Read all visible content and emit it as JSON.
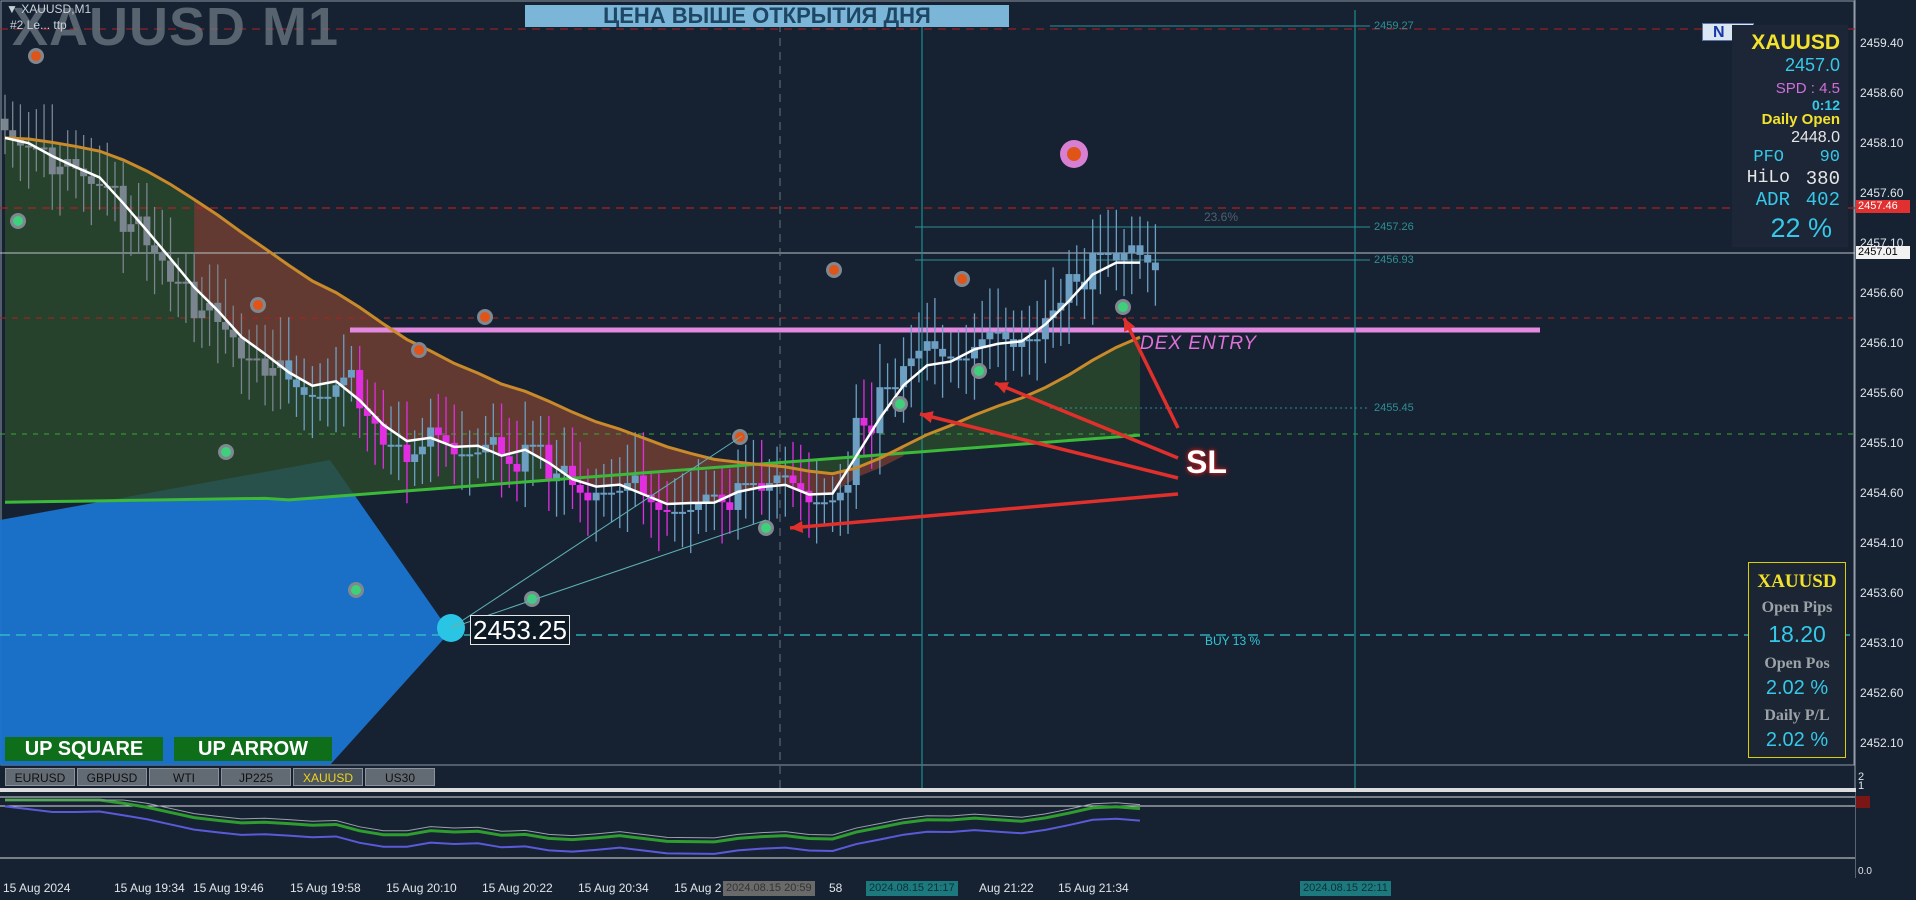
{
  "window": {
    "symbol_title": "XAUUSD M1",
    "small_line1": "▼ XAUUSD,M1",
    "small_line2": "#2 Le... ttp"
  },
  "banner": {
    "text": "ЦЕНА ВЫШЕ ОТКРЫТИЯ ДНЯ"
  },
  "news_badge": {
    "text": "N"
  },
  "info_panel": {
    "symbol": "XAUUSD",
    "price": "2457.0",
    "spread": "SPD : 4.5",
    "timer": "0:12",
    "daily_open_label": "Daily Open",
    "daily_open_value": "2448.0",
    "pfo_label": "PFO",
    "pfo_value": "90",
    "hilo_label": "HiLo",
    "hilo_value": "380",
    "adr_label": "ADR",
    "adr_value": "402",
    "percent": "22 %"
  },
  "account_panel": {
    "symbol": "XAUUSD",
    "open_pips_label": "Open Pips",
    "open_pips_value": "18.20",
    "open_pos_label": "Open Pos",
    "open_pos_value": "2.02 %",
    "daily_pl_label": "Daily P/L",
    "daily_pl_value": "2.02 %"
  },
  "price_axis": {
    "labels": [
      "2459.40",
      "2458.60",
      "2458.10",
      "2457.60",
      "2457.10",
      "2456.60",
      "2456.10",
      "2455.60",
      "2455.10",
      "2454.60",
      "2454.10",
      "2453.60",
      "2453.10",
      "2452.60",
      "2452.10"
    ],
    "current_price": "2457.01",
    "red_price": "2457.46"
  },
  "level_labels": {
    "l1": "2459.27",
    "l2": "2457.26",
    "l3": "2456.93",
    "l4": "2455.45",
    "fib": "23.6%",
    "buy": "BUY 13 %",
    "pink": "DEX ENTRY"
  },
  "price_marker": {
    "text": "2453.25"
  },
  "sl_label": {
    "text": "SL"
  },
  "buttons": {
    "up_square": "UP SQUARE",
    "up_arrow": "UP ARROW"
  },
  "symbol_tabs": [
    "EURUSD",
    "GBPUSD",
    "WTI",
    "JP225",
    "XAUUSD",
    "US30"
  ],
  "active_tab": "XAUUSD",
  "sub_window": {
    "scale_top": "2",
    "scale_bottom": "1",
    "bottom_value": "0.0"
  },
  "time_axis": {
    "labels": [
      "15 Aug 2024",
      "15 Aug 19:34",
      "15 Aug 19:46",
      "15 Aug 19:58",
      "15 Aug 20:10",
      "15 Aug 20:22",
      "15 Aug 20:34",
      "15 Aug 2",
      "58",
      "Aug 21:22",
      "15 Aug 21:34"
    ],
    "crosshair_time_1": "2024.08.15 20:59",
    "crosshair_time_2": "2024.08.15 21:17",
    "crosshair_time_3": "2024.08.15 22:11"
  },
  "chart_data": {
    "type": "candlestick",
    "symbol": "XAUUSD",
    "timeframe": "M1",
    "ylim": [
      2452.0,
      2459.6
    ],
    "close_series": [
      2458.4,
      2458.3,
      2458.1,
      2458.0,
      2457.9,
      2457.5,
      2457.2,
      2456.9,
      2456.6,
      2456.4,
      2456.1,
      2456.0,
      2455.8,
      2455.7,
      2455.9,
      2455.5,
      2455.2,
      2455.1,
      2455.3,
      2455.1,
      2455.2,
      2455.0,
      2455.2,
      2454.9,
      2454.7,
      2454.7,
      2454.8,
      2454.6,
      2454.5,
      2454.6,
      2454.6,
      2454.8,
      2454.8,
      2454.8,
      2454.6,
      2454.7,
      2455.4,
      2455.8,
      2456.1,
      2456.2,
      2456.1,
      2456.3,
      2456.3,
      2456.3,
      2456.6,
      2456.9,
      2457.2,
      2457.2,
      2457.1
    ],
    "annotations": [
      "SL",
      "DEX ENTRY",
      "BUY 13 %",
      "23.6%"
    ]
  }
}
